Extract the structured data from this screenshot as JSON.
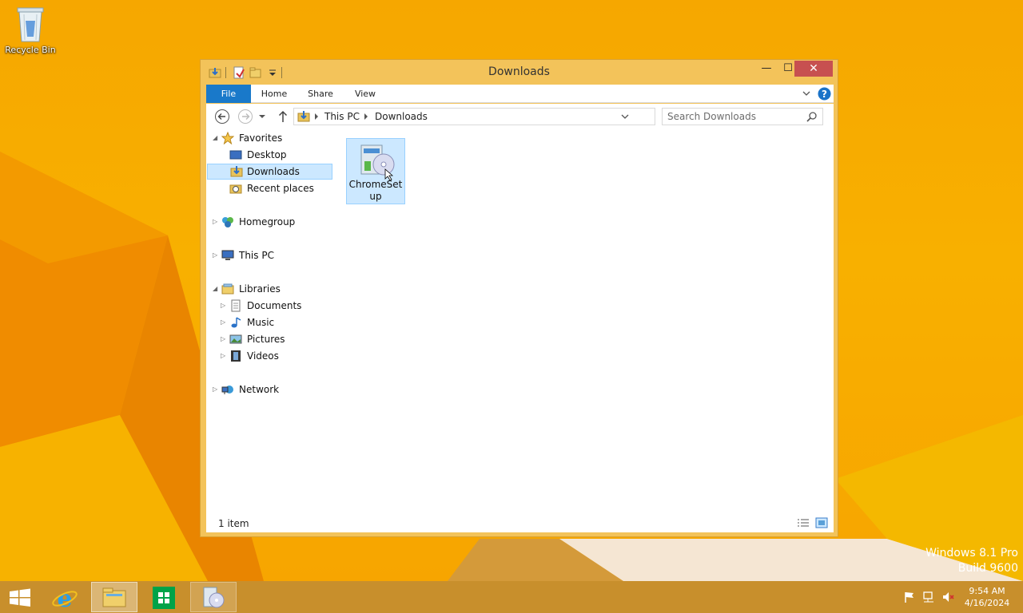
{
  "desktop": {
    "recycle_bin_label": "Recycle Bin",
    "watermark_line1": "Windows 8.1 Pro",
    "watermark_line2": "Build 9600"
  },
  "window": {
    "title": "Downloads",
    "controls": {
      "minimize": "—",
      "maximize": "☐",
      "close": "✕"
    },
    "ribbon_tabs": [
      "File",
      "Home",
      "Share",
      "View"
    ],
    "address": {
      "crumbs": [
        "This PC",
        "Downloads"
      ]
    },
    "search": {
      "placeholder": "Search Downloads"
    },
    "nav": {
      "favorites": "Favorites",
      "desktop": "Desktop",
      "downloads": "Downloads",
      "recent_places": "Recent places",
      "homegroup": "Homegroup",
      "this_pc": "This PC",
      "libraries": "Libraries",
      "documents": "Documents",
      "music": "Music",
      "pictures": "Pictures",
      "videos": "Videos",
      "network": "Network"
    },
    "files": [
      {
        "name": "ChromeSetup"
      }
    ],
    "status": "1 item"
  },
  "taskbar": {
    "time": "9:54 AM",
    "date": "4/16/2024"
  },
  "colors": {
    "wallpaper": "#f7a800",
    "window_frame": "#f3c35a",
    "file_tab": "#1979ca",
    "close_button": "#c75050",
    "selection": "#cce8ff"
  }
}
